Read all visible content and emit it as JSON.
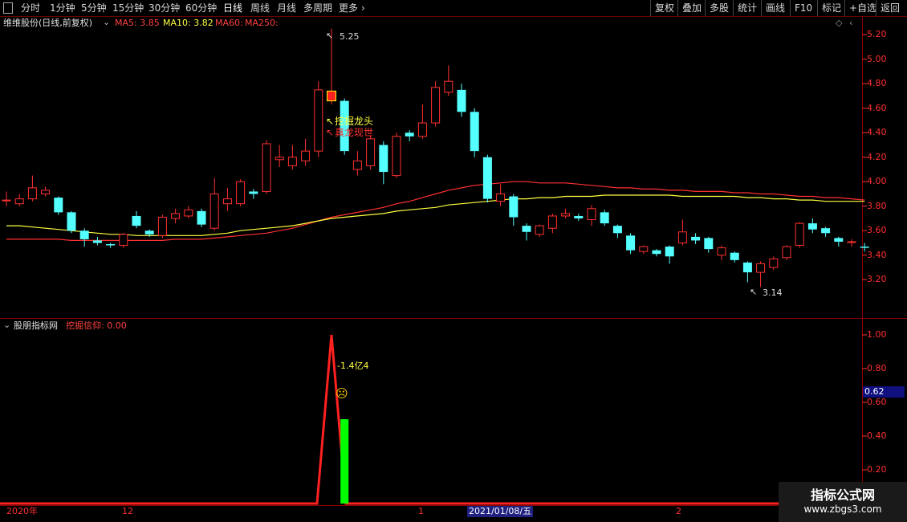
{
  "toolbar": {
    "tabs": [
      "分时",
      "1分钟",
      "5分钟",
      "15分钟",
      "30分钟",
      "60分钟",
      "日线",
      "周线",
      "月线",
      "多周期",
      "更多"
    ],
    "active": "日线",
    "right_buttons": [
      "复权",
      "叠加",
      "多股",
      "统计",
      "画线",
      "F10",
      "标记",
      "+自选",
      "返回"
    ]
  },
  "main": {
    "stock": "维维股份(日线,前复权)",
    "ma5": "MA5: 3.85",
    "ma10": "MA10: 3.82",
    "ma60": "MA60:",
    "ma250": "MA250:",
    "high_label": "5.25",
    "low_label": "3.14",
    "signal1": "挖掘龙头",
    "signal2": "真龙现世",
    "yticks": [
      "5.20",
      "5.00",
      "4.80",
      "4.60",
      "4.40",
      "4.20",
      "4.00",
      "3.80",
      "3.60",
      "3.40",
      "3.20"
    ]
  },
  "indicator": {
    "name": "股朋指标网",
    "line_label": "挖掘信仰: 0.00",
    "annotation": "-1.4亿4",
    "current_value": "0.62",
    "yticks": [
      "1.00",
      "0.80",
      "0.60",
      "0.40",
      "0.20"
    ]
  },
  "xaxis": {
    "year": "2020年",
    "m12": "12",
    "m1": "1",
    "cursor_date": "2021/01/08/五",
    "m2": "2"
  },
  "logo": {
    "line1": "指标公式网",
    "line2": "www.zbgs3.com"
  },
  "colors": {
    "up": "#ff3030",
    "down": "#54ffff",
    "ma5": "#ffffff",
    "ma10": "#ffff00",
    "ma60": "#ff3030",
    "bg": "#000000"
  },
  "chart_data": {
    "type": "candlestick",
    "ylim": [
      3.1,
      5.3
    ],
    "candles": [
      {
        "o": 3.85,
        "c": 3.85,
        "h": 3.92,
        "l": 3.8
      },
      {
        "o": 3.82,
        "c": 3.86,
        "h": 3.9,
        "l": 3.8
      },
      {
        "o": 3.86,
        "c": 3.95,
        "h": 4.05,
        "l": 3.84
      },
      {
        "o": 3.9,
        "c": 3.93,
        "h": 3.96,
        "l": 3.88
      },
      {
        "o": 3.87,
        "c": 3.75,
        "h": 3.88,
        "l": 3.73
      },
      {
        "o": 3.75,
        "c": 3.6,
        "h": 3.76,
        "l": 3.58
      },
      {
        "o": 3.6,
        "c": 3.53,
        "h": 3.62,
        "l": 3.47
      },
      {
        "o": 3.52,
        "c": 3.5,
        "h": 3.55,
        "l": 3.48
      },
      {
        "o": 3.49,
        "c": 3.48,
        "h": 3.5,
        "l": 3.46
      },
      {
        "o": 3.48,
        "c": 3.57,
        "h": 3.58,
        "l": 3.46
      },
      {
        "o": 3.72,
        "c": 3.64,
        "h": 3.76,
        "l": 3.62
      },
      {
        "o": 3.6,
        "c": 3.57,
        "h": 3.61,
        "l": 3.55
      },
      {
        "o": 3.56,
        "c": 3.71,
        "h": 3.73,
        "l": 3.54
      },
      {
        "o": 3.7,
        "c": 3.74,
        "h": 3.78,
        "l": 3.66
      },
      {
        "o": 3.72,
        "c": 3.77,
        "h": 3.8,
        "l": 3.7
      },
      {
        "o": 3.76,
        "c": 3.65,
        "h": 3.78,
        "l": 3.63
      },
      {
        "o": 3.62,
        "c": 3.9,
        "h": 4.03,
        "l": 3.6
      },
      {
        "o": 3.82,
        "c": 3.86,
        "h": 3.95,
        "l": 3.76
      },
      {
        "o": 3.82,
        "c": 4.0,
        "h": 4.02,
        "l": 3.8
      },
      {
        "o": 3.92,
        "c": 3.9,
        "h": 3.94,
        "l": 3.86
      },
      {
        "o": 3.92,
        "c": 4.31,
        "h": 4.34,
        "l": 3.9
      },
      {
        "o": 4.18,
        "c": 4.2,
        "h": 4.3,
        "l": 4.12
      },
      {
        "o": 4.13,
        "c": 4.2,
        "h": 4.3,
        "l": 4.1
      },
      {
        "o": 4.17,
        "c": 4.25,
        "h": 4.35,
        "l": 4.13
      },
      {
        "o": 4.25,
        "c": 4.75,
        "h": 4.82,
        "l": 4.2
      },
      {
        "o": 4.66,
        "c": 4.74,
        "h": 5.25,
        "l": 4.63
      },
      {
        "o": 4.66,
        "c": 4.25,
        "h": 4.68,
        "l": 4.22
      },
      {
        "o": 4.1,
        "c": 4.17,
        "h": 4.25,
        "l": 4.05
      },
      {
        "o": 4.13,
        "c": 4.35,
        "h": 4.38,
        "l": 4.1
      },
      {
        "o": 4.3,
        "c": 4.08,
        "h": 4.33,
        "l": 3.98
      },
      {
        "o": 4.05,
        "c": 4.37,
        "h": 4.4,
        "l": 4.03
      },
      {
        "o": 4.4,
        "c": 4.37,
        "h": 4.42,
        "l": 4.33
      },
      {
        "o": 4.37,
        "c": 4.48,
        "h": 4.63,
        "l": 4.35
      },
      {
        "o": 4.48,
        "c": 4.77,
        "h": 4.82,
        "l": 4.45
      },
      {
        "o": 4.73,
        "c": 4.82,
        "h": 4.95,
        "l": 4.7
      },
      {
        "o": 4.75,
        "c": 4.57,
        "h": 4.8,
        "l": 4.53
      },
      {
        "o": 4.57,
        "c": 4.25,
        "h": 4.6,
        "l": 4.2
      },
      {
        "o": 4.2,
        "c": 3.86,
        "h": 4.22,
        "l": 3.83
      },
      {
        "o": 3.84,
        "c": 3.9,
        "h": 3.98,
        "l": 3.8
      },
      {
        "o": 3.88,
        "c": 3.71,
        "h": 3.9,
        "l": 3.64
      },
      {
        "o": 3.64,
        "c": 3.59,
        "h": 3.66,
        "l": 3.52
      },
      {
        "o": 3.57,
        "c": 3.64,
        "h": 3.65,
        "l": 3.55
      },
      {
        "o": 3.62,
        "c": 3.72,
        "h": 3.74,
        "l": 3.58
      },
      {
        "o": 3.72,
        "c": 3.74,
        "h": 3.78,
        "l": 3.7
      },
      {
        "o": 3.72,
        "c": 3.7,
        "h": 3.74,
        "l": 3.68
      },
      {
        "o": 3.69,
        "c": 3.78,
        "h": 3.81,
        "l": 3.64
      },
      {
        "o": 3.75,
        "c": 3.66,
        "h": 3.77,
        "l": 3.64
      },
      {
        "o": 3.64,
        "c": 3.58,
        "h": 3.65,
        "l": 3.54
      },
      {
        "o": 3.56,
        "c": 3.44,
        "h": 3.58,
        "l": 3.41
      },
      {
        "o": 3.43,
        "c": 3.47,
        "h": 3.48,
        "l": 3.41
      },
      {
        "o": 3.44,
        "c": 3.41,
        "h": 3.45,
        "l": 3.39
      },
      {
        "o": 3.47,
        "c": 3.39,
        "h": 3.48,
        "l": 3.33
      },
      {
        "o": 3.5,
        "c": 3.59,
        "h": 3.69,
        "l": 3.48
      },
      {
        "o": 3.55,
        "c": 3.52,
        "h": 3.58,
        "l": 3.49
      },
      {
        "o": 3.54,
        "c": 3.45,
        "h": 3.55,
        "l": 3.42
      },
      {
        "o": 3.4,
        "c": 3.46,
        "h": 3.48,
        "l": 3.36
      },
      {
        "o": 3.42,
        "c": 3.36,
        "h": 3.43,
        "l": 3.34
      },
      {
        "o": 3.34,
        "c": 3.26,
        "h": 3.35,
        "l": 3.18
      },
      {
        "o": 3.26,
        "c": 3.33,
        "h": 3.35,
        "l": 3.14
      },
      {
        "o": 3.3,
        "c": 3.37,
        "h": 3.39,
        "l": 3.28
      },
      {
        "o": 3.38,
        "c": 3.47,
        "h": 3.48,
        "l": 3.36
      },
      {
        "o": 3.48,
        "c": 3.66,
        "h": 3.67,
        "l": 3.46
      },
      {
        "o": 3.66,
        "c": 3.61,
        "h": 3.7,
        "l": 3.58
      },
      {
        "o": 3.62,
        "c": 3.58,
        "h": 3.63,
        "l": 3.55
      },
      {
        "o": 3.54,
        "c": 3.51,
        "h": 3.55,
        "l": 3.47
      },
      {
        "o": 3.51,
        "c": 3.51,
        "h": 3.53,
        "l": 3.47
      },
      {
        "o": 3.47,
        "c": 3.46,
        "h": 3.5,
        "l": 3.43
      }
    ],
    "ma_yellow": [
      3.64,
      3.64,
      3.63,
      3.62,
      3.61,
      3.6,
      3.59,
      3.58,
      3.57,
      3.57,
      3.56,
      3.56,
      3.56,
      3.56,
      3.56,
      3.56,
      3.57,
      3.58,
      3.6,
      3.61,
      3.62,
      3.63,
      3.64,
      3.66,
      3.68,
      3.7,
      3.71,
      3.72,
      3.73,
      3.74,
      3.76,
      3.77,
      3.78,
      3.79,
      3.81,
      3.82,
      3.83,
      3.84,
      3.85,
      3.86,
      3.86,
      3.87,
      3.87,
      3.88,
      3.88,
      3.88,
      3.89,
      3.89,
      3.89,
      3.89,
      3.89,
      3.89,
      3.88,
      3.88,
      3.88,
      3.88,
      3.88,
      3.87,
      3.87,
      3.86,
      3.86,
      3.85,
      3.85,
      3.84,
      3.84,
      3.84,
      3.84
    ],
    "ma_red": [
      3.53,
      3.53,
      3.53,
      3.53,
      3.53,
      3.52,
      3.52,
      3.52,
      3.52,
      3.52,
      3.52,
      3.52,
      3.52,
      3.53,
      3.53,
      3.53,
      3.54,
      3.55,
      3.56,
      3.57,
      3.58,
      3.6,
      3.62,
      3.65,
      3.68,
      3.71,
      3.73,
      3.75,
      3.77,
      3.79,
      3.82,
      3.84,
      3.87,
      3.9,
      3.93,
      3.95,
      3.97,
      3.98,
      3.99,
      4.0,
      4.0,
      3.99,
      3.99,
      3.99,
      3.98,
      3.97,
      3.96,
      3.95,
      3.95,
      3.94,
      3.94,
      3.93,
      3.93,
      3.92,
      3.92,
      3.92,
      3.91,
      3.91,
      3.9,
      3.9,
      3.89,
      3.88,
      3.88,
      3.87,
      3.87,
      3.86,
      3.85
    ],
    "indicator": {
      "ylim": [
        0,
        1.1
      ],
      "peak_index": 25,
      "peak_value": 1.0,
      "bar_index": 26,
      "bar_value": 0.5
    }
  }
}
